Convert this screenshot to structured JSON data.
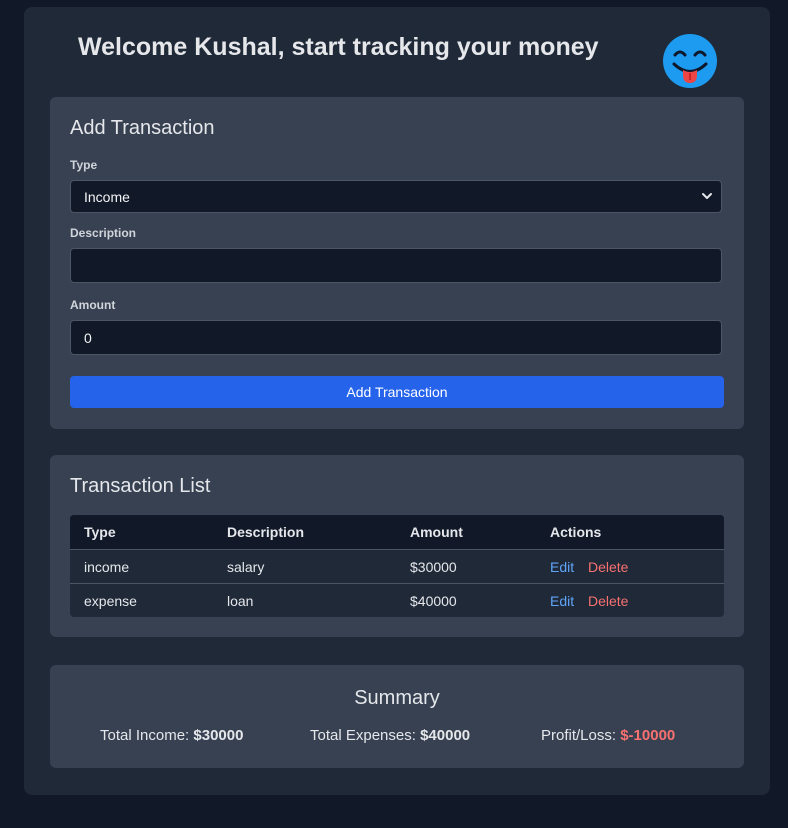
{
  "header": {
    "title": "Welcome Kushal, start tracking your money",
    "avatar_icon": "tongue-out-emoji-icon",
    "avatar_color": "#1d9bf0"
  },
  "add_transaction": {
    "title": "Add Transaction",
    "type_label": "Type",
    "type_value": "Income",
    "description_label": "Description",
    "description_value": "",
    "amount_label": "Amount",
    "amount_value": "0",
    "submit_label": "Add Transaction"
  },
  "transaction_list": {
    "title": "Transaction List",
    "columns": [
      "Type",
      "Description",
      "Amount",
      "Actions"
    ],
    "rows": [
      {
        "type": "income",
        "description": "salary",
        "amount": "$30000",
        "edit": "Edit",
        "delete": "Delete"
      },
      {
        "type": "expense",
        "description": "loan",
        "amount": "$40000",
        "edit": "Edit",
        "delete": "Delete"
      }
    ]
  },
  "summary": {
    "title": "Summary",
    "income_label": "Total Income:",
    "income_value": "$30000",
    "expenses_label": "Total Expenses:",
    "expenses_value": "$40000",
    "profit_label": "Profit/Loss:",
    "profit_value": "$-10000"
  },
  "colors": {
    "background": "#111827",
    "panel": "#1f2937",
    "card": "#374151",
    "accent": "#2563eb",
    "link": "#60a5fa",
    "danger": "#f87171"
  }
}
